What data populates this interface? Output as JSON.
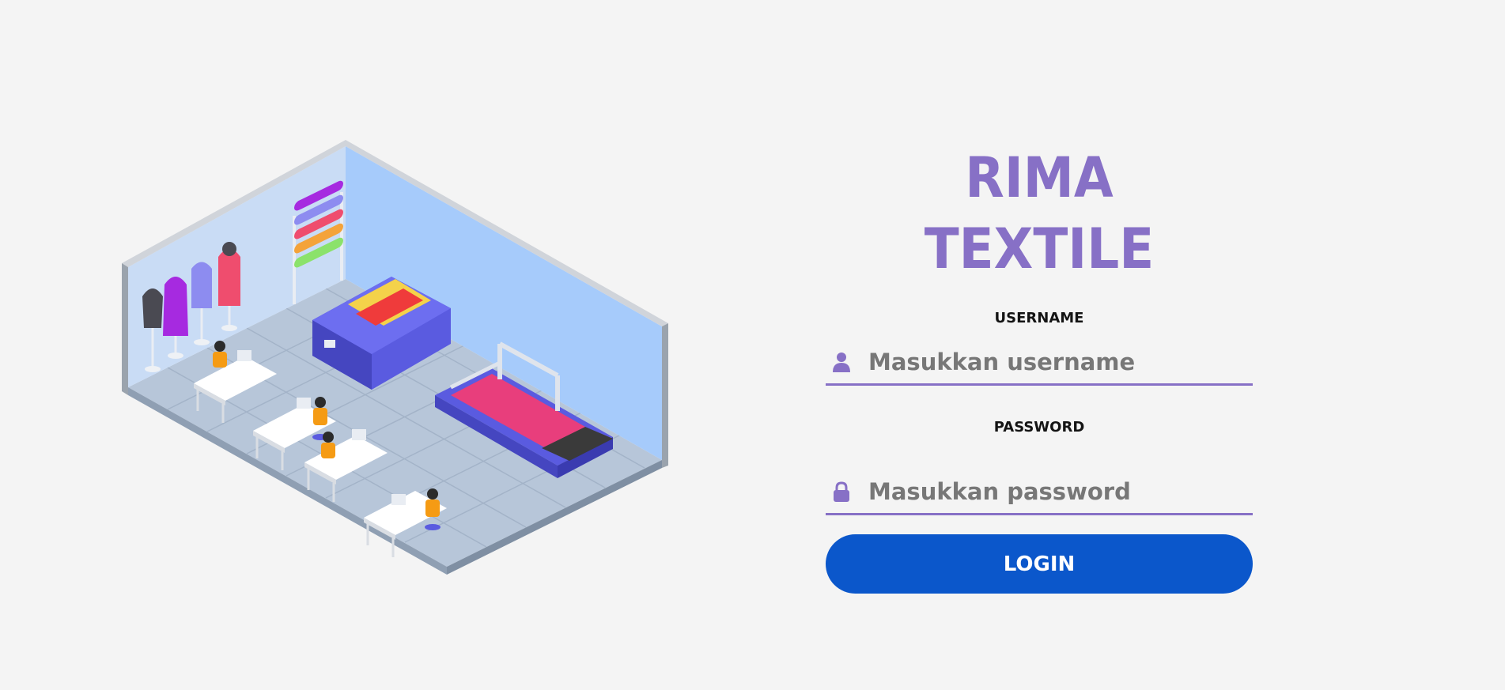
{
  "brand": {
    "title": "RIMA TEXTILE",
    "accent_color": "#8770c6"
  },
  "form": {
    "username_label": "USERNAME",
    "username_placeholder": "Masukkan username",
    "username_icon": "user-icon",
    "password_label": "PASSWORD",
    "password_placeholder": "Masukkan password",
    "password_icon": "lock-icon",
    "login_label": "LOGIN",
    "button_color": "#0b57cb"
  },
  "illustration": {
    "icon": "textile-factory-illustration"
  }
}
